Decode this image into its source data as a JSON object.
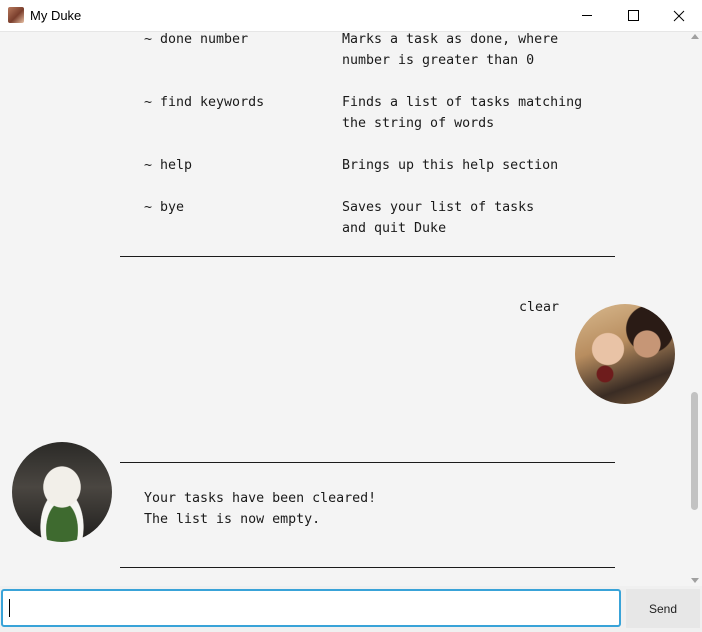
{
  "window": {
    "title": "My Duke",
    "icon": "app-avatar-icon"
  },
  "help_commands": [
    {
      "command": "~ done number",
      "desc_line1": "Marks a task as done, where",
      "desc_line2": "number is greater than 0"
    },
    {
      "command": "~ find keywords",
      "desc_line1": "Finds a list of tasks matching",
      "desc_line2": "the string of words"
    },
    {
      "command": "~ help",
      "desc_line1": "Brings up this help section",
      "desc_line2": ""
    },
    {
      "command": "~ bye",
      "desc_line1": "Saves your list of tasks",
      "desc_line2": "and quit Duke"
    }
  ],
  "user_message": {
    "text": "clear"
  },
  "bot_reply": {
    "line1": "Your tasks have been cleared!",
    "line2": "The list is now empty."
  },
  "input": {
    "value": "",
    "placeholder": ""
  },
  "send_button": {
    "label": "Send"
  },
  "colors": {
    "background": "#f4f4f4",
    "input_focus_border": "#39a3d8",
    "send_button_bg": "#e7e7e7"
  }
}
